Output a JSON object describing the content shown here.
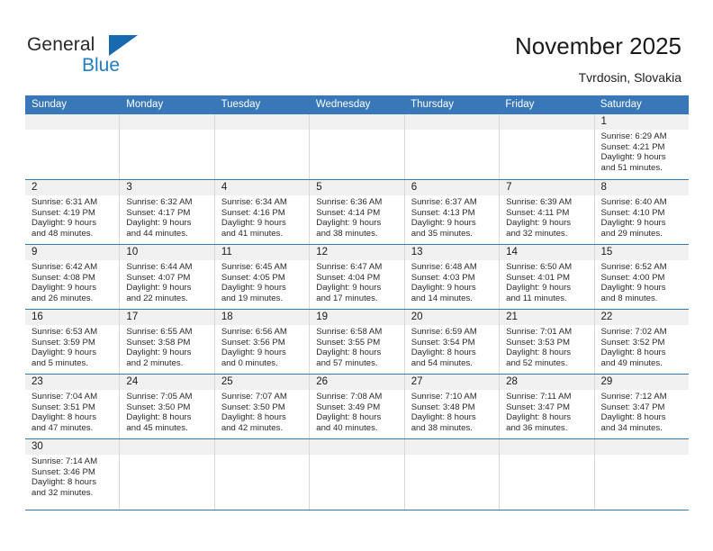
{
  "brand": {
    "name_top": "General",
    "name_bottom": "Blue",
    "triangle_color": "#1769b0",
    "blue_text_color": "#1f7ec4"
  },
  "header": {
    "title": "November 2025",
    "subtitle": "Tvrdosin, Slovakia",
    "accent_color": "#3878b8"
  },
  "weekdays": [
    "Sunday",
    "Monday",
    "Tuesday",
    "Wednesday",
    "Thursday",
    "Friday",
    "Saturday"
  ],
  "labels": {
    "sunrise_prefix": "Sunrise:",
    "sunset_prefix": "Sunset:",
    "daylight_prefix": "Daylight:"
  },
  "weeks": [
    [
      {
        "blank": true
      },
      {
        "blank": true
      },
      {
        "blank": true
      },
      {
        "blank": true
      },
      {
        "blank": true
      },
      {
        "blank": true
      },
      {
        "date": "1",
        "sunrise": "Sunrise: 6:29 AM",
        "sunset": "Sunset: 4:21 PM",
        "daylight1": "Daylight: 9 hours",
        "daylight2": "and 51 minutes."
      }
    ],
    [
      {
        "date": "2",
        "sunrise": "Sunrise: 6:31 AM",
        "sunset": "Sunset: 4:19 PM",
        "daylight1": "Daylight: 9 hours",
        "daylight2": "and 48 minutes."
      },
      {
        "date": "3",
        "sunrise": "Sunrise: 6:32 AM",
        "sunset": "Sunset: 4:17 PM",
        "daylight1": "Daylight: 9 hours",
        "daylight2": "and 44 minutes."
      },
      {
        "date": "4",
        "sunrise": "Sunrise: 6:34 AM",
        "sunset": "Sunset: 4:16 PM",
        "daylight1": "Daylight: 9 hours",
        "daylight2": "and 41 minutes."
      },
      {
        "date": "5",
        "sunrise": "Sunrise: 6:36 AM",
        "sunset": "Sunset: 4:14 PM",
        "daylight1": "Daylight: 9 hours",
        "daylight2": "and 38 minutes."
      },
      {
        "date": "6",
        "sunrise": "Sunrise: 6:37 AM",
        "sunset": "Sunset: 4:13 PM",
        "daylight1": "Daylight: 9 hours",
        "daylight2": "and 35 minutes."
      },
      {
        "date": "7",
        "sunrise": "Sunrise: 6:39 AM",
        "sunset": "Sunset: 4:11 PM",
        "daylight1": "Daylight: 9 hours",
        "daylight2": "and 32 minutes."
      },
      {
        "date": "8",
        "sunrise": "Sunrise: 6:40 AM",
        "sunset": "Sunset: 4:10 PM",
        "daylight1": "Daylight: 9 hours",
        "daylight2": "and 29 minutes."
      }
    ],
    [
      {
        "date": "9",
        "sunrise": "Sunrise: 6:42 AM",
        "sunset": "Sunset: 4:08 PM",
        "daylight1": "Daylight: 9 hours",
        "daylight2": "and 26 minutes."
      },
      {
        "date": "10",
        "sunrise": "Sunrise: 6:44 AM",
        "sunset": "Sunset: 4:07 PM",
        "daylight1": "Daylight: 9 hours",
        "daylight2": "and 22 minutes."
      },
      {
        "date": "11",
        "sunrise": "Sunrise: 6:45 AM",
        "sunset": "Sunset: 4:05 PM",
        "daylight1": "Daylight: 9 hours",
        "daylight2": "and 19 minutes."
      },
      {
        "date": "12",
        "sunrise": "Sunrise: 6:47 AM",
        "sunset": "Sunset: 4:04 PM",
        "daylight1": "Daylight: 9 hours",
        "daylight2": "and 17 minutes."
      },
      {
        "date": "13",
        "sunrise": "Sunrise: 6:48 AM",
        "sunset": "Sunset: 4:03 PM",
        "daylight1": "Daylight: 9 hours",
        "daylight2": "and 14 minutes."
      },
      {
        "date": "14",
        "sunrise": "Sunrise: 6:50 AM",
        "sunset": "Sunset: 4:01 PM",
        "daylight1": "Daylight: 9 hours",
        "daylight2": "and 11 minutes."
      },
      {
        "date": "15",
        "sunrise": "Sunrise: 6:52 AM",
        "sunset": "Sunset: 4:00 PM",
        "daylight1": "Daylight: 9 hours",
        "daylight2": "and 8 minutes."
      }
    ],
    [
      {
        "date": "16",
        "sunrise": "Sunrise: 6:53 AM",
        "sunset": "Sunset: 3:59 PM",
        "daylight1": "Daylight: 9 hours",
        "daylight2": "and 5 minutes."
      },
      {
        "date": "17",
        "sunrise": "Sunrise: 6:55 AM",
        "sunset": "Sunset: 3:58 PM",
        "daylight1": "Daylight: 9 hours",
        "daylight2": "and 2 minutes."
      },
      {
        "date": "18",
        "sunrise": "Sunrise: 6:56 AM",
        "sunset": "Sunset: 3:56 PM",
        "daylight1": "Daylight: 9 hours",
        "daylight2": "and 0 minutes."
      },
      {
        "date": "19",
        "sunrise": "Sunrise: 6:58 AM",
        "sunset": "Sunset: 3:55 PM",
        "daylight1": "Daylight: 8 hours",
        "daylight2": "and 57 minutes."
      },
      {
        "date": "20",
        "sunrise": "Sunrise: 6:59 AM",
        "sunset": "Sunset: 3:54 PM",
        "daylight1": "Daylight: 8 hours",
        "daylight2": "and 54 minutes."
      },
      {
        "date": "21",
        "sunrise": "Sunrise: 7:01 AM",
        "sunset": "Sunset: 3:53 PM",
        "daylight1": "Daylight: 8 hours",
        "daylight2": "and 52 minutes."
      },
      {
        "date": "22",
        "sunrise": "Sunrise: 7:02 AM",
        "sunset": "Sunset: 3:52 PM",
        "daylight1": "Daylight: 8 hours",
        "daylight2": "and 49 minutes."
      }
    ],
    [
      {
        "date": "23",
        "sunrise": "Sunrise: 7:04 AM",
        "sunset": "Sunset: 3:51 PM",
        "daylight1": "Daylight: 8 hours",
        "daylight2": "and 47 minutes."
      },
      {
        "date": "24",
        "sunrise": "Sunrise: 7:05 AM",
        "sunset": "Sunset: 3:50 PM",
        "daylight1": "Daylight: 8 hours",
        "daylight2": "and 45 minutes."
      },
      {
        "date": "25",
        "sunrise": "Sunrise: 7:07 AM",
        "sunset": "Sunset: 3:50 PM",
        "daylight1": "Daylight: 8 hours",
        "daylight2": "and 42 minutes."
      },
      {
        "date": "26",
        "sunrise": "Sunrise: 7:08 AM",
        "sunset": "Sunset: 3:49 PM",
        "daylight1": "Daylight: 8 hours",
        "daylight2": "and 40 minutes."
      },
      {
        "date": "27",
        "sunrise": "Sunrise: 7:10 AM",
        "sunset": "Sunset: 3:48 PM",
        "daylight1": "Daylight: 8 hours",
        "daylight2": "and 38 minutes."
      },
      {
        "date": "28",
        "sunrise": "Sunrise: 7:11 AM",
        "sunset": "Sunset: 3:47 PM",
        "daylight1": "Daylight: 8 hours",
        "daylight2": "and 36 minutes."
      },
      {
        "date": "29",
        "sunrise": "Sunrise: 7:12 AM",
        "sunset": "Sunset: 3:47 PM",
        "daylight1": "Daylight: 8 hours",
        "daylight2": "and 34 minutes."
      }
    ],
    [
      {
        "date": "30",
        "sunrise": "Sunrise: 7:14 AM",
        "sunset": "Sunset: 3:46 PM",
        "daylight1": "Daylight: 8 hours",
        "daylight2": "and 32 minutes."
      },
      {
        "blank": true
      },
      {
        "blank": true
      },
      {
        "blank": true
      },
      {
        "blank": true
      },
      {
        "blank": true
      },
      {
        "blank": true
      }
    ]
  ]
}
